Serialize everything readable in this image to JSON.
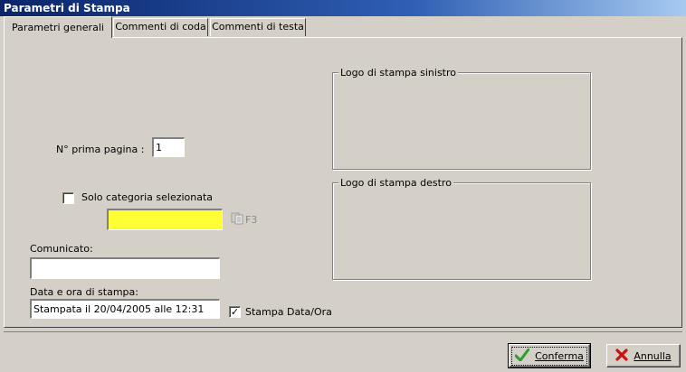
{
  "window": {
    "title": "Parametri di Stampa"
  },
  "tabs": [
    {
      "label": "Parametri generali",
      "active": true
    },
    {
      "label": "Commenti di coda",
      "active": false
    },
    {
      "label": "Commenti di testa",
      "active": false
    }
  ],
  "form": {
    "first_page_label": "N° prima pagina :",
    "first_page_value": "1",
    "solo_categoria_label": "Solo categoria selezionata",
    "solo_categoria_checked": false,
    "category_value": "",
    "f3_label": "F3",
    "comunicato_label": "Comunicato:",
    "comunicato_value": "",
    "data_ora_label": "Data e ora di stampa:",
    "data_ora_value": "Stampata il 20/04/2005 alle 12:31",
    "stampa_data_label": "Stampa Data/Ora",
    "stampa_data_checked": true
  },
  "logos": {
    "left_label": "Logo di stampa sinistro",
    "right_label": "Logo di stampa destro"
  },
  "buttons": {
    "confirm_label": "Conferma",
    "cancel_label": "Annulla"
  },
  "colors": {
    "title_bar": "#0a246a",
    "highlight_field": "#ffff33",
    "confirm_icon": "#2e9e2e",
    "cancel_icon": "#cc1111"
  }
}
